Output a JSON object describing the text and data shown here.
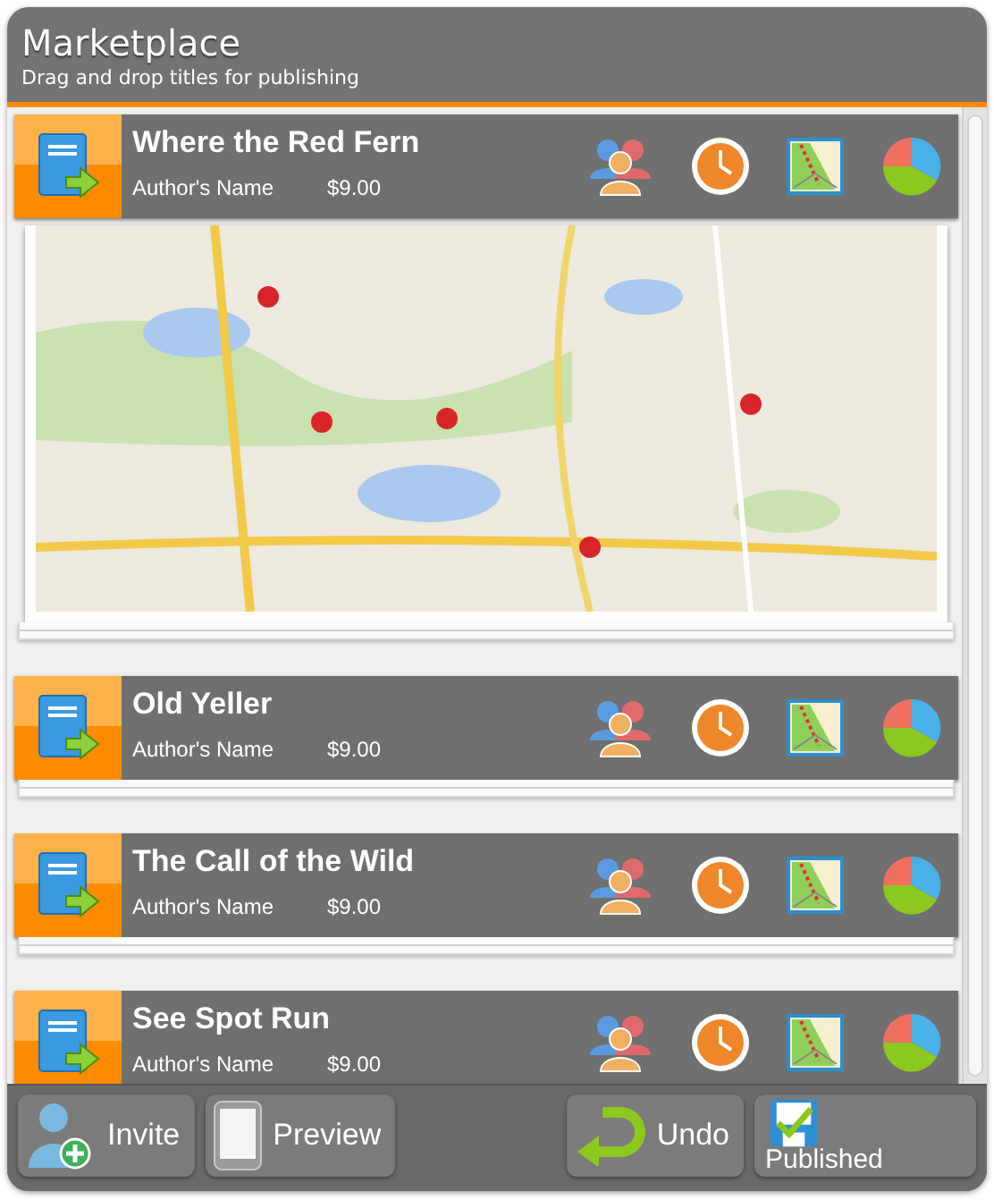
{
  "header": {
    "title": "Marketplace",
    "subtitle": "Drag and drop titles for publishing"
  },
  "titles": [
    {
      "title": "Where the Red Fern",
      "author": "Author's Name",
      "price": "$9.00",
      "expanded": true
    },
    {
      "title": "Old Yeller",
      "author": "Author's Name",
      "price": "$9.00",
      "expanded": false
    },
    {
      "title": "The Call of the Wild",
      "author": "Author's Name",
      "price": "$9.00",
      "expanded": false
    },
    {
      "title": "See Spot Run",
      "author": "Author's Name",
      "price": "$9.00",
      "expanded": false
    }
  ],
  "toolbar": [
    {
      "kind": "invite",
      "label": "Invite"
    },
    {
      "kind": "preview",
      "label": "Preview"
    },
    {
      "kind": "undo",
      "label": "Undo"
    },
    {
      "kind": "published",
      "label": "Published"
    }
  ]
}
